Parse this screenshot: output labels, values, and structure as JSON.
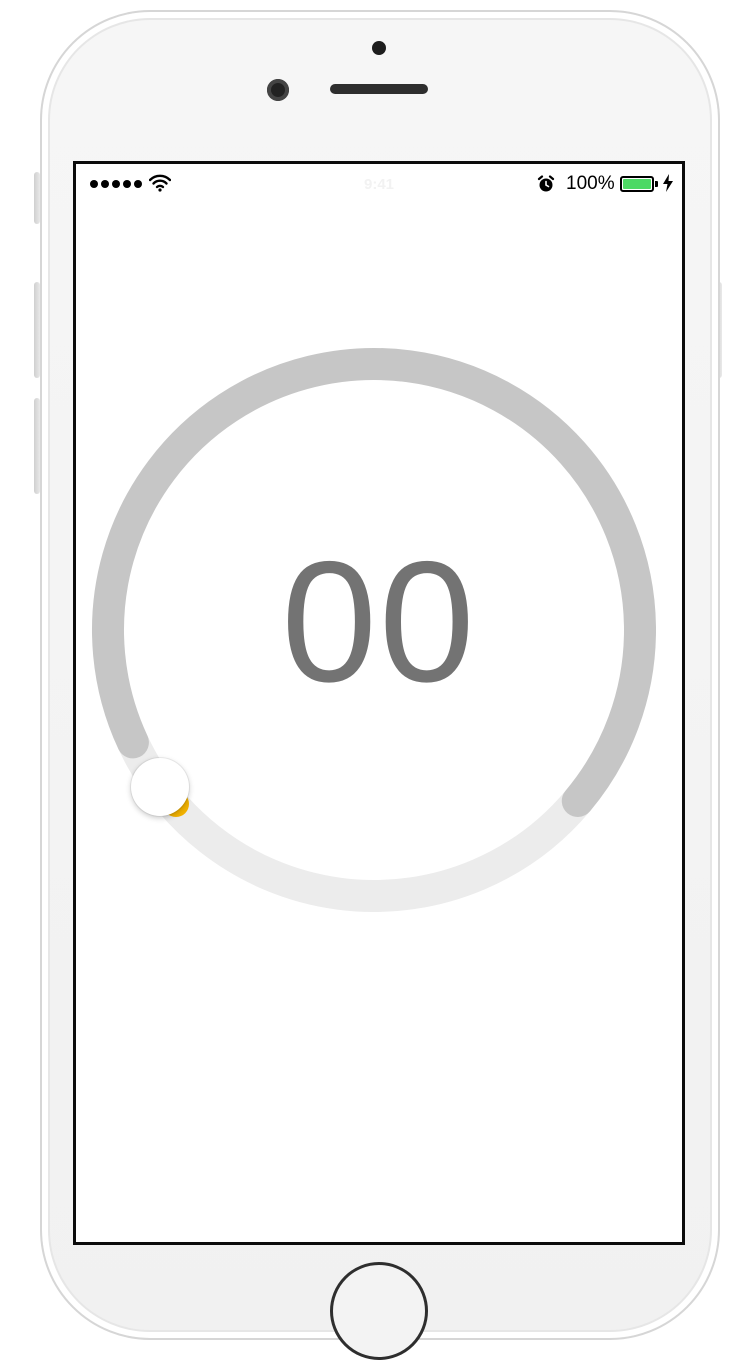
{
  "status_bar": {
    "signal_dots": 5,
    "carrier_time": "9:41",
    "battery_percent_text": "100%",
    "battery_level": 1.0,
    "icons": [
      "wifi-icon",
      "alarm-icon",
      "battery-icon",
      "charging-bolt-icon"
    ]
  },
  "dial": {
    "value_text": "00",
    "progress": 0,
    "colors": {
      "track_active": "#c6c6c6",
      "track_inactive": "#ececec",
      "knob_accent": "#f2b200",
      "value": "#737373"
    }
  },
  "device": {
    "frame_color": "#f3f3f3",
    "screen_border": "#0b0b0b"
  }
}
